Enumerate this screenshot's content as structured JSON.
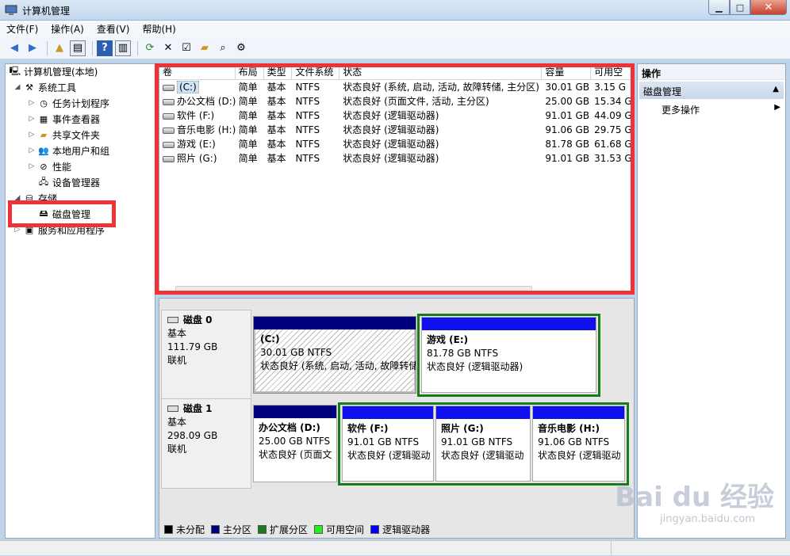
{
  "window": {
    "title": "计算机管理",
    "min": "▁",
    "max": "□",
    "close": "✕"
  },
  "menu": [
    "文件(F)",
    "操作(A)",
    "查看(V)",
    "帮助(H)"
  ],
  "tree": {
    "root": "计算机管理(本地)",
    "system_tools": "系统工具",
    "task_scheduler": "任务计划程序",
    "event_viewer": "事件查看器",
    "shared_folders": "共享文件夹",
    "local_users": "本地用户和组",
    "performance": "性能",
    "device_manager": "设备管理器",
    "storage": "存储",
    "disk_management": "磁盘管理",
    "services_apps": "服务和应用程序"
  },
  "volume_table": {
    "headers": [
      "卷",
      "布局",
      "类型",
      "文件系统",
      "状态",
      "容量",
      "可用空"
    ],
    "rows": [
      [
        "(C:)",
        "简单",
        "基本",
        "NTFS",
        "状态良好 (系统, 启动, 活动, 故障转储, 主分区)",
        "30.01 GB",
        "3.15 G"
      ],
      [
        "办公文档 (D:)",
        "简单",
        "基本",
        "NTFS",
        "状态良好 (页面文件, 活动, 主分区)",
        "25.00 GB",
        "15.34 G"
      ],
      [
        "软件 (F:)",
        "简单",
        "基本",
        "NTFS",
        "状态良好 (逻辑驱动器)",
        "91.01 GB",
        "44.09 G"
      ],
      [
        "音乐电影 (H:)",
        "简单",
        "基本",
        "NTFS",
        "状态良好 (逻辑驱动器)",
        "91.06 GB",
        "29.75 G"
      ],
      [
        "游戏 (E:)",
        "简单",
        "基本",
        "NTFS",
        "状态良好 (逻辑驱动器)",
        "81.78 GB",
        "61.68 G"
      ],
      [
        "照片 (G:)",
        "简单",
        "基本",
        "NTFS",
        "状态良好 (逻辑驱动器)",
        "91.01 GB",
        "31.53 G"
      ]
    ]
  },
  "disks": [
    {
      "name": "磁盘 0",
      "type": "基本",
      "size": "111.79 GB",
      "status": "联机",
      "partitions": [
        {
          "name": "(C:)",
          "size": "30.01 GB NTFS",
          "status": "状态良好 (系统, 启动, 活动, 故障转储"
        },
        {
          "name": "游戏  (E:)",
          "size": "81.78 GB NTFS",
          "status": "状态良好 (逻辑驱动器)"
        }
      ]
    },
    {
      "name": "磁盘 1",
      "type": "基本",
      "size": "298.09 GB",
      "status": "联机",
      "partitions": [
        {
          "name": "办公文档  (D:)",
          "size": "25.00 GB NTFS",
          "status": "状态良好 (页面文"
        },
        {
          "name": "软件  (F:)",
          "size": "91.01 GB NTFS",
          "status": "状态良好 (逻辑驱动"
        },
        {
          "name": "照片  (G:)",
          "size": "91.01 GB NTFS",
          "status": "状态良好 (逻辑驱动"
        },
        {
          "name": "音乐电影  (H:)",
          "size": "91.06 GB NTFS",
          "status": "状态良好 (逻辑驱动"
        }
      ]
    }
  ],
  "legend": [
    {
      "label": "未分配",
      "color": "#000000"
    },
    {
      "label": "主分区",
      "color": "#00007f"
    },
    {
      "label": "扩展分区",
      "color": "#1b7a1b"
    },
    {
      "label": "可用空间",
      "color": "#22ee22"
    },
    {
      "label": "逻辑驱动器",
      "color": "#0000ff"
    }
  ],
  "actions": {
    "header": "操作",
    "section": "磁盘管理",
    "more": "更多操作"
  },
  "colors": {
    "primary_bar": "#00007f",
    "logical_bar": "#1010ee",
    "highlight": "#ee3238"
  },
  "watermark": {
    "brand": "Bai  du 经验",
    "url": "jingyan.baidu.com"
  }
}
